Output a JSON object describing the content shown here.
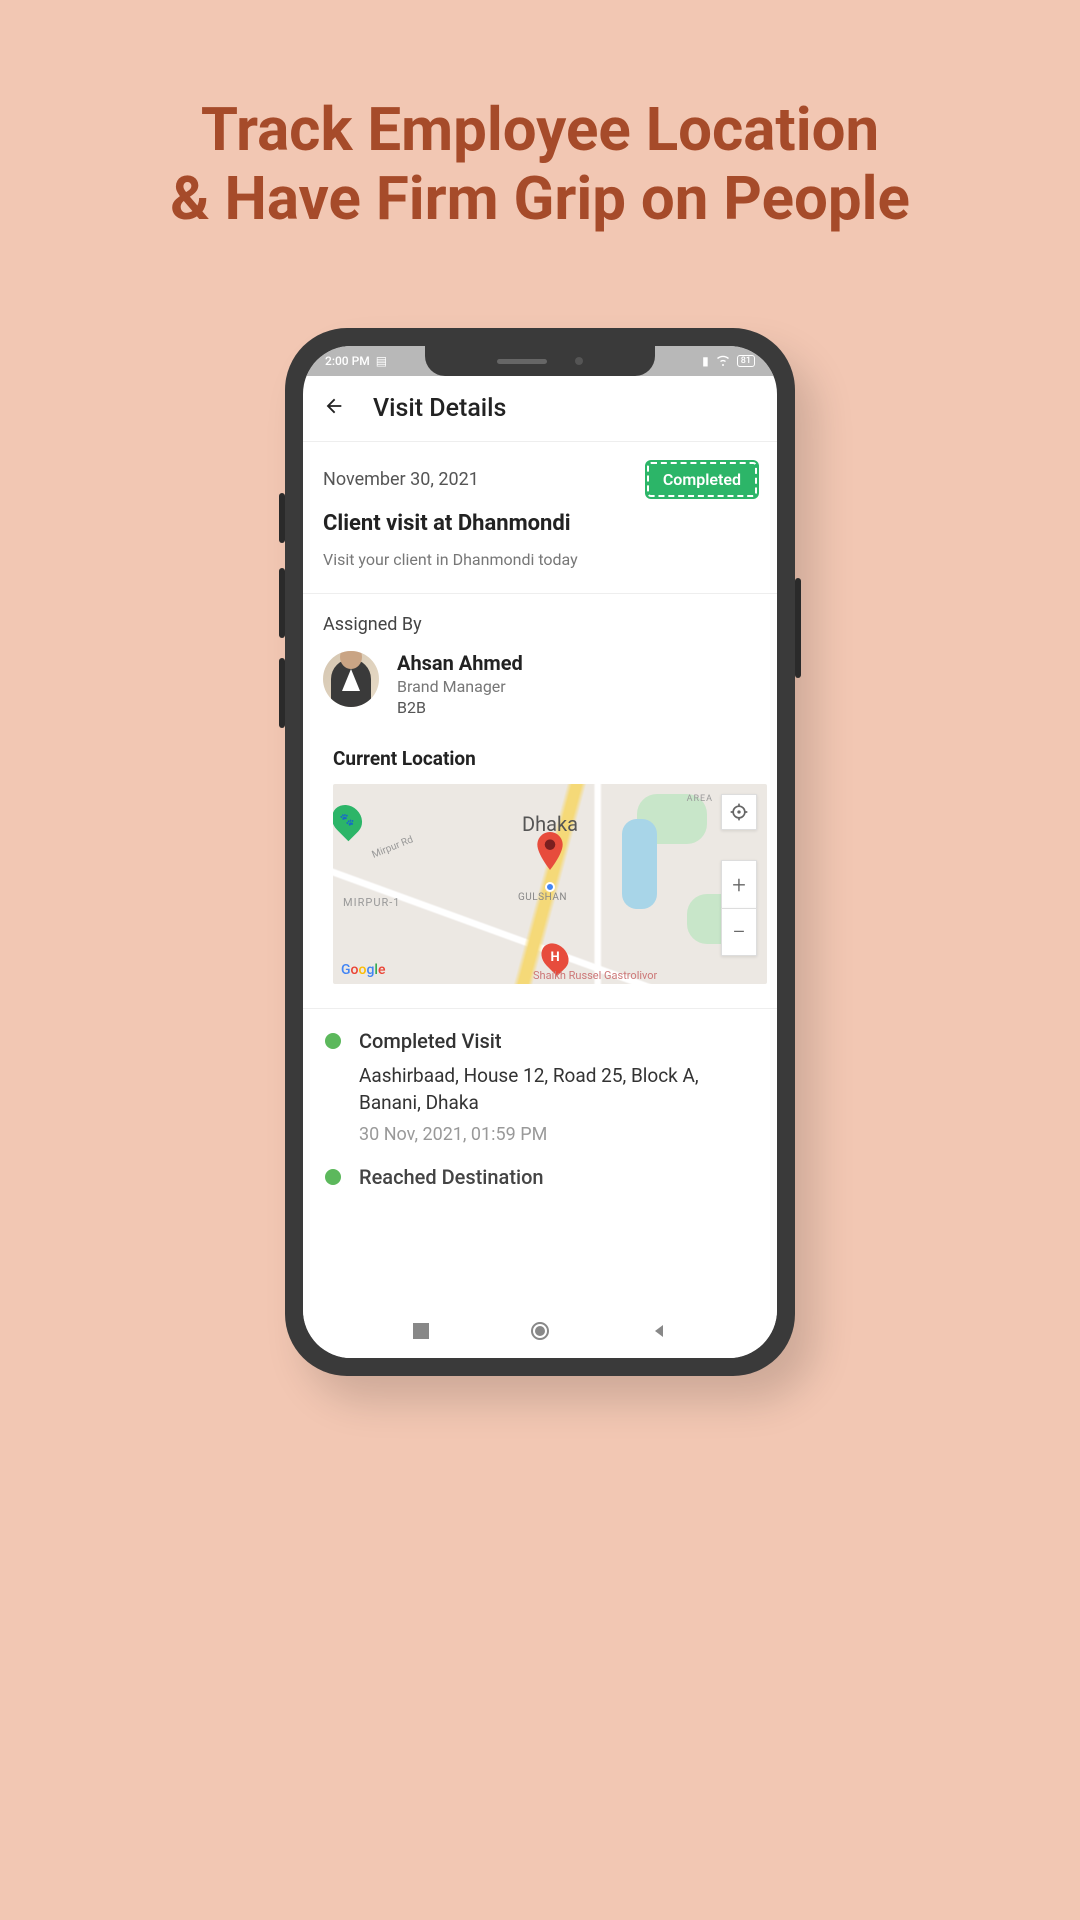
{
  "headline": {
    "line1": "Track Employee Location",
    "line2": "& Have Firm Grip on People"
  },
  "status_bar": {
    "time": "2:00 PM",
    "battery": "81"
  },
  "header": {
    "title": "Visit Details"
  },
  "visit": {
    "date": "November 30, 2021",
    "status": "Completed",
    "title": "Client visit at Dhanmondi",
    "description": "Visit your client in Dhanmondi today"
  },
  "assigned": {
    "label": "Assigned By",
    "name": "Ahsan Ahmed",
    "role": "Brand Manager",
    "department": "B2B"
  },
  "location": {
    "label": "Current Location",
    "city": "Dhaka",
    "area1": "MIRPUR-1",
    "area2": "GULSHAN",
    "road": "Mirpur Rd",
    "area_btn": "AREA",
    "google": "Google",
    "cut_text": "Shaikh Russel Gastrolivor"
  },
  "timeline": [
    {
      "title": "Completed Visit",
      "address": "Aashirbaad, House 12, Road 25, Block A, Banani, Dhaka",
      "time": "30 Nov, 2021, 01:59 PM"
    },
    {
      "title": "Reached Destination",
      "address": "",
      "time": ""
    }
  ]
}
